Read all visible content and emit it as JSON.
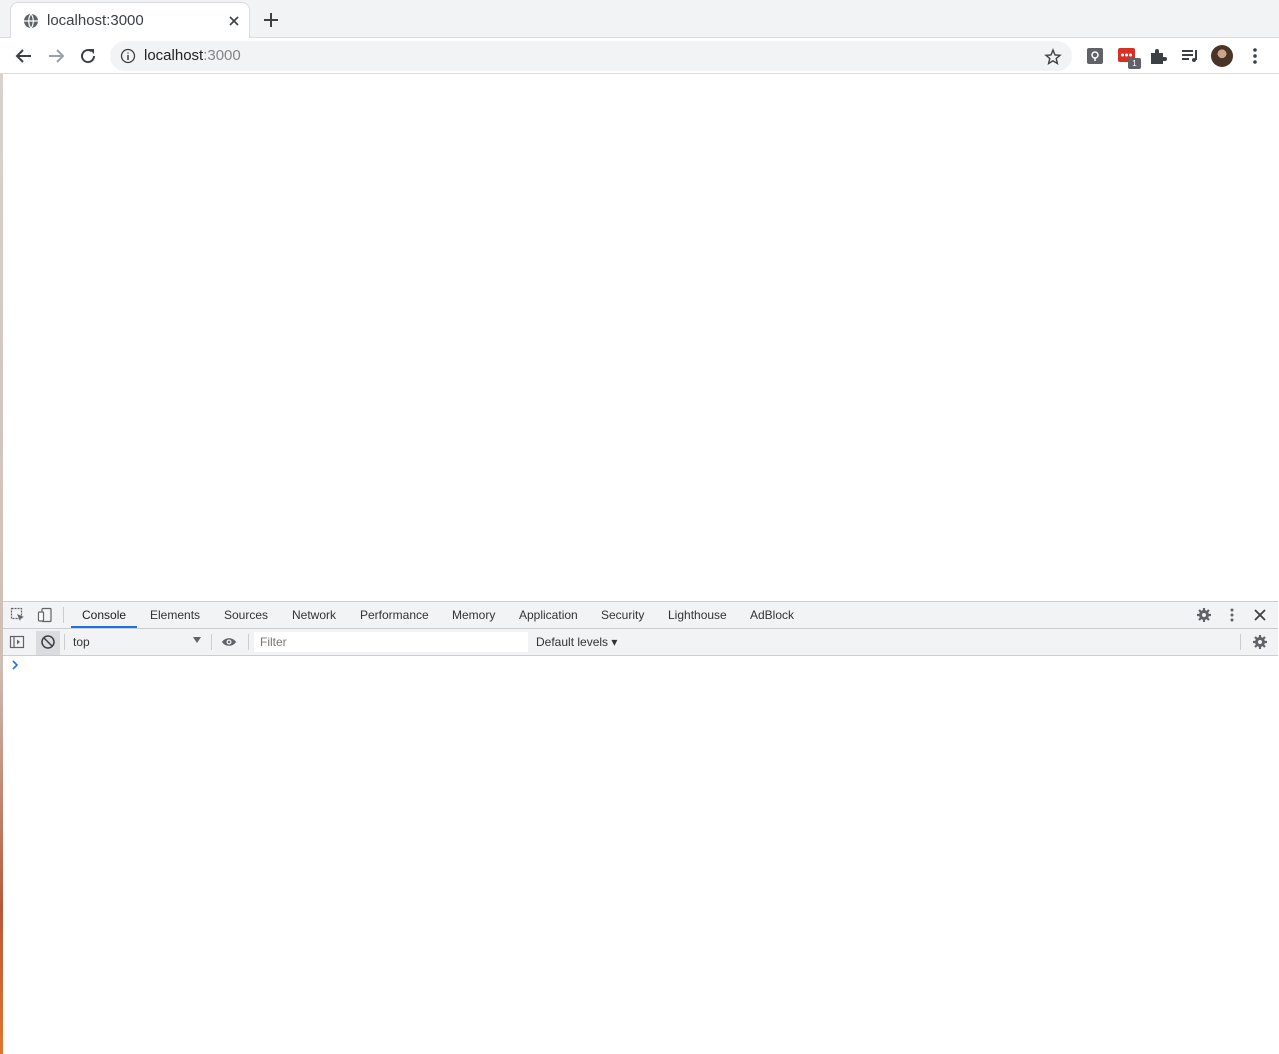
{
  "browser": {
    "tab": {
      "title": "localhost:3000",
      "favicon": "globe-icon"
    },
    "omnibox": {
      "host": "localhost",
      "port": ":3000"
    },
    "extension_badge": "1",
    "colors": {
      "accent": "#1a73e8",
      "extension_red": "#d93025"
    }
  },
  "devtools": {
    "tabs": [
      {
        "label": "Console",
        "active": true
      },
      {
        "label": "Elements"
      },
      {
        "label": "Sources"
      },
      {
        "label": "Network"
      },
      {
        "label": "Performance"
      },
      {
        "label": "Memory"
      },
      {
        "label": "Application"
      },
      {
        "label": "Security"
      },
      {
        "label": "Lighthouse"
      },
      {
        "label": "AdBlock"
      }
    ],
    "console": {
      "context": "top",
      "filter_placeholder": "Filter",
      "levels": "Default levels ▾",
      "prompt": "›"
    }
  }
}
